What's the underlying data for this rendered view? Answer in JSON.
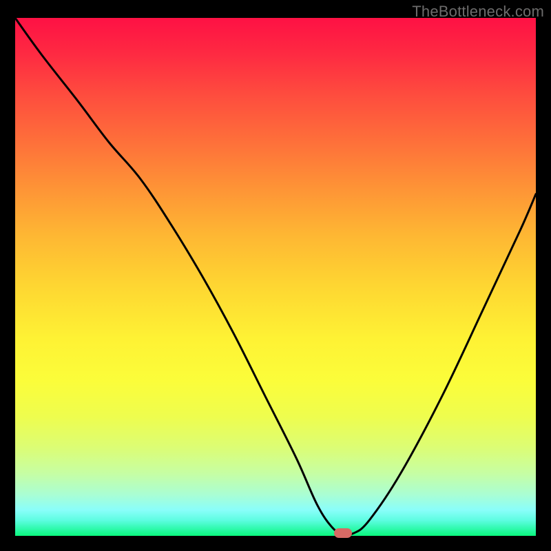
{
  "watermark": "TheBottleneck.com",
  "colors": {
    "frame_bg": "#000000",
    "curve_stroke": "#000000",
    "marker_fill": "#d76a65",
    "gradient_stops": [
      "#fe1144",
      "#fe2a42",
      "#fe4d3e",
      "#fe703a",
      "#fe9436",
      "#feb733",
      "#fed732",
      "#fef234",
      "#fbfd3a",
      "#eefd4e",
      "#dcfd75",
      "#c6fea4",
      "#aafed3",
      "#8afefa",
      "#5dfde1",
      "#24f9a0",
      "#0af77e"
    ]
  },
  "chart_data": {
    "type": "line",
    "title": "",
    "xlabel": "",
    "ylabel": "",
    "xlim": [
      0,
      100
    ],
    "ylim": [
      0,
      100
    ],
    "grid": false,
    "legend": false,
    "marker": {
      "x": 63,
      "y": 0.5
    },
    "series": [
      {
        "name": "bottleneck-curve",
        "x": [
          0,
          5,
          12,
          18,
          24,
          30,
          36,
          42,
          48,
          54,
          58,
          61,
          63,
          65,
          68,
          74,
          82,
          90,
          97,
          100
        ],
        "y": [
          100,
          93,
          84,
          76,
          69,
          60,
          50,
          39,
          27,
          15,
          6,
          1.5,
          0.5,
          0.5,
          3,
          12,
          27,
          44,
          59,
          66
        ]
      }
    ],
    "notes": "Curve represents bottleneck magnitude (0 = no bottleneck, 100 = max). Minimum around x≈63. Values estimated from plot."
  }
}
